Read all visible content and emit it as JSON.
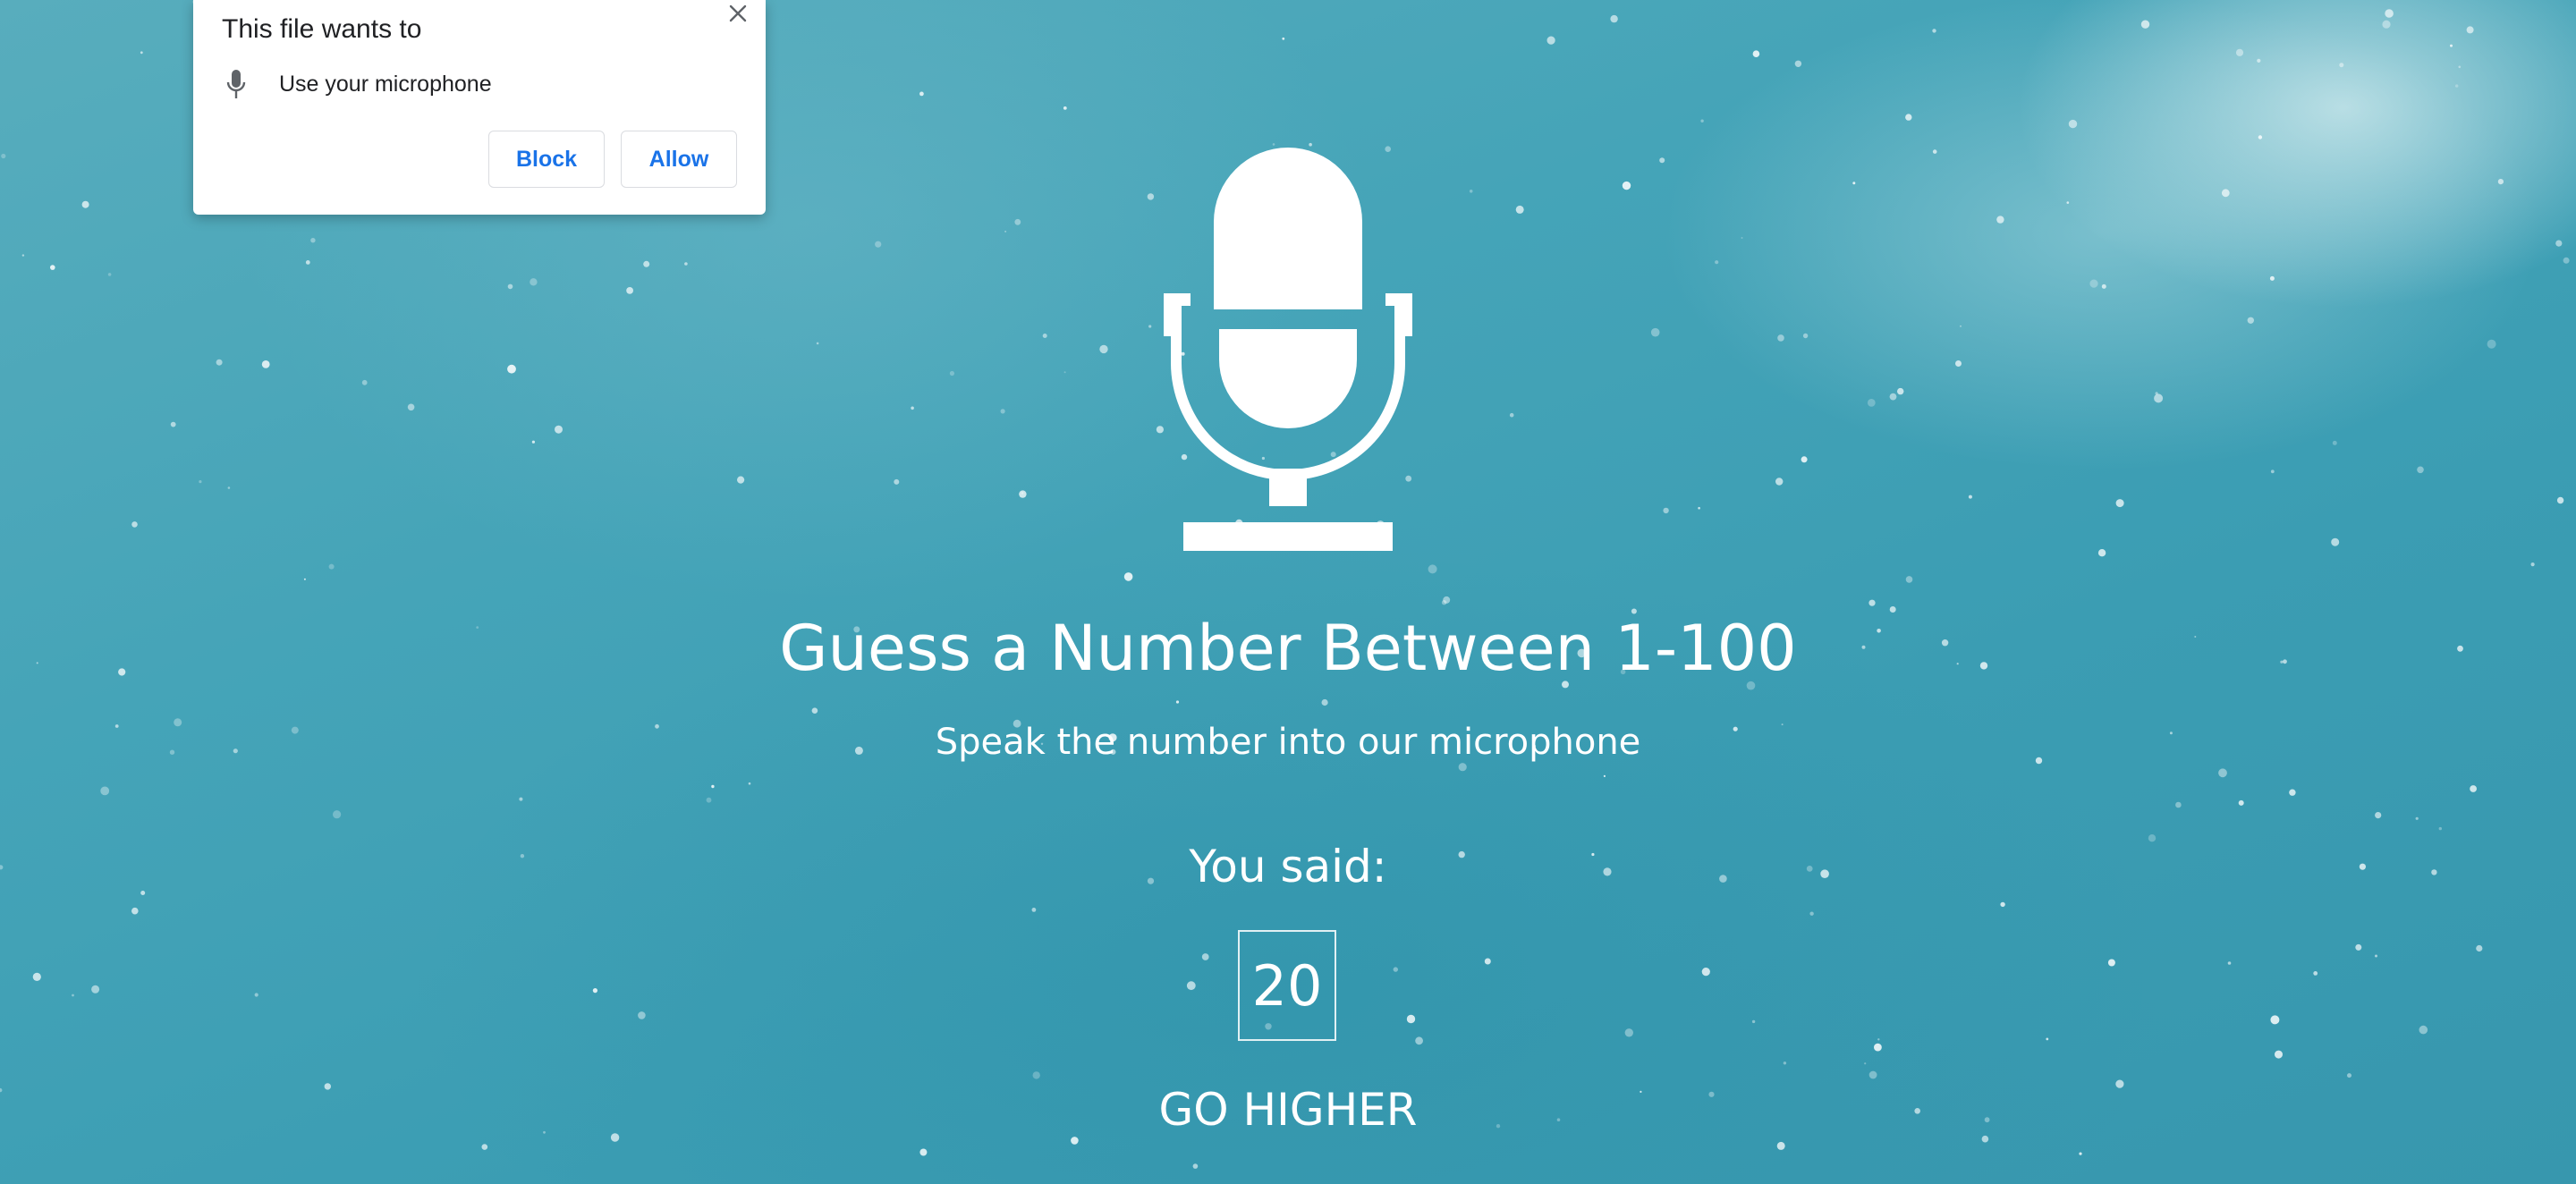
{
  "permission_prompt": {
    "title": "This file wants to",
    "permission_label": "Use your microphone",
    "permission_icon": "microphone-icon",
    "close_icon": "close-icon",
    "block_label": "Block",
    "allow_label": "Allow",
    "button_text_color": "#1a73e8"
  },
  "game": {
    "icon": "microphone-icon",
    "title": "Guess a Number Between 1-100",
    "subtitle": "Speak the number into our microphone",
    "you_said_label": "You said:",
    "guess_value": "20",
    "hint": "GO HIGHER"
  },
  "colors": {
    "background": "#45a4b8",
    "foreground": "#ffffff"
  }
}
